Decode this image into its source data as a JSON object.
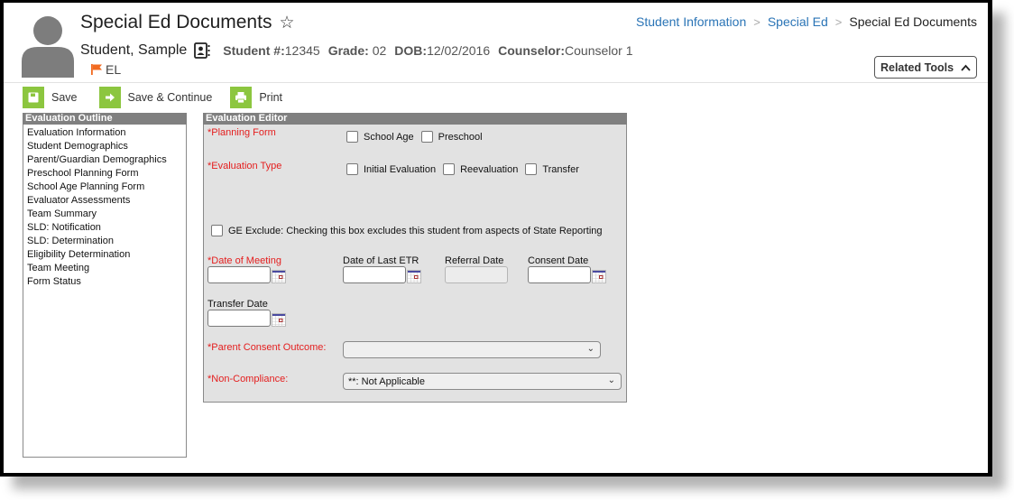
{
  "header": {
    "title": "Special Ed Documents",
    "student_name": "Student, Sample",
    "student_number_label": "Student #:",
    "student_number": "12345",
    "grade_label": "Grade:",
    "grade": "02",
    "dob_label": "DOB:",
    "dob": "12/02/2016",
    "counselor_label": "Counselor:",
    "counselor": "Counselor 1",
    "flag_label": "EL",
    "flag_color": "#f26b21"
  },
  "breadcrumb": {
    "items": [
      "Student Information",
      "Special Ed"
    ],
    "current": "Special Ed Documents",
    "separator": ">"
  },
  "related_tools": {
    "label": "Related Tools",
    "icon": "chevron-up-icon"
  },
  "toolbar": {
    "save": "Save",
    "save_continue": "Save & Continue",
    "print": "Print",
    "accent": "#8cc63f"
  },
  "outline": {
    "title": "Evaluation Outline",
    "items": [
      "Evaluation Information",
      "Student Demographics",
      "Parent/Guardian Demographics",
      "Preschool Planning Form",
      "School Age Planning Form",
      "Evaluator Assessments",
      "Team Summary",
      "SLD: Notification",
      "SLD: Determination",
      "Eligibility Determination",
      "Team Meeting",
      "Form Status"
    ]
  },
  "editor": {
    "title": "Evaluation Editor",
    "planning_form": {
      "label": "*Planning Form",
      "options": [
        {
          "label": "School Age",
          "checked": false
        },
        {
          "label": "Preschool",
          "checked": false
        }
      ]
    },
    "evaluation_type": {
      "label": "*Evaluation Type",
      "options": [
        {
          "label": "Initial Evaluation",
          "checked": false
        },
        {
          "label": "Reevaluation",
          "checked": false
        },
        {
          "label": "Transfer",
          "checked": false
        }
      ]
    },
    "ge_exclude": {
      "label": "GE Exclude: Checking this box excludes this student from aspects of State Reporting",
      "checked": false
    },
    "date_of_meeting": {
      "label": "*Date of Meeting",
      "value": ""
    },
    "date_last_etr": {
      "label": "Date of Last ETR",
      "value": ""
    },
    "referral_date": {
      "label": "Referral Date",
      "value": "",
      "disabled": true
    },
    "consent_date": {
      "label": "Consent Date",
      "value": ""
    },
    "transfer_date": {
      "label": "Transfer Date",
      "value": ""
    },
    "parent_consent_outcome": {
      "label": "*Parent Consent Outcome:",
      "value": ""
    },
    "non_compliance": {
      "label": "*Non-Compliance:",
      "value": "**: Not Applicable"
    },
    "required_color": "#e41e1e"
  }
}
